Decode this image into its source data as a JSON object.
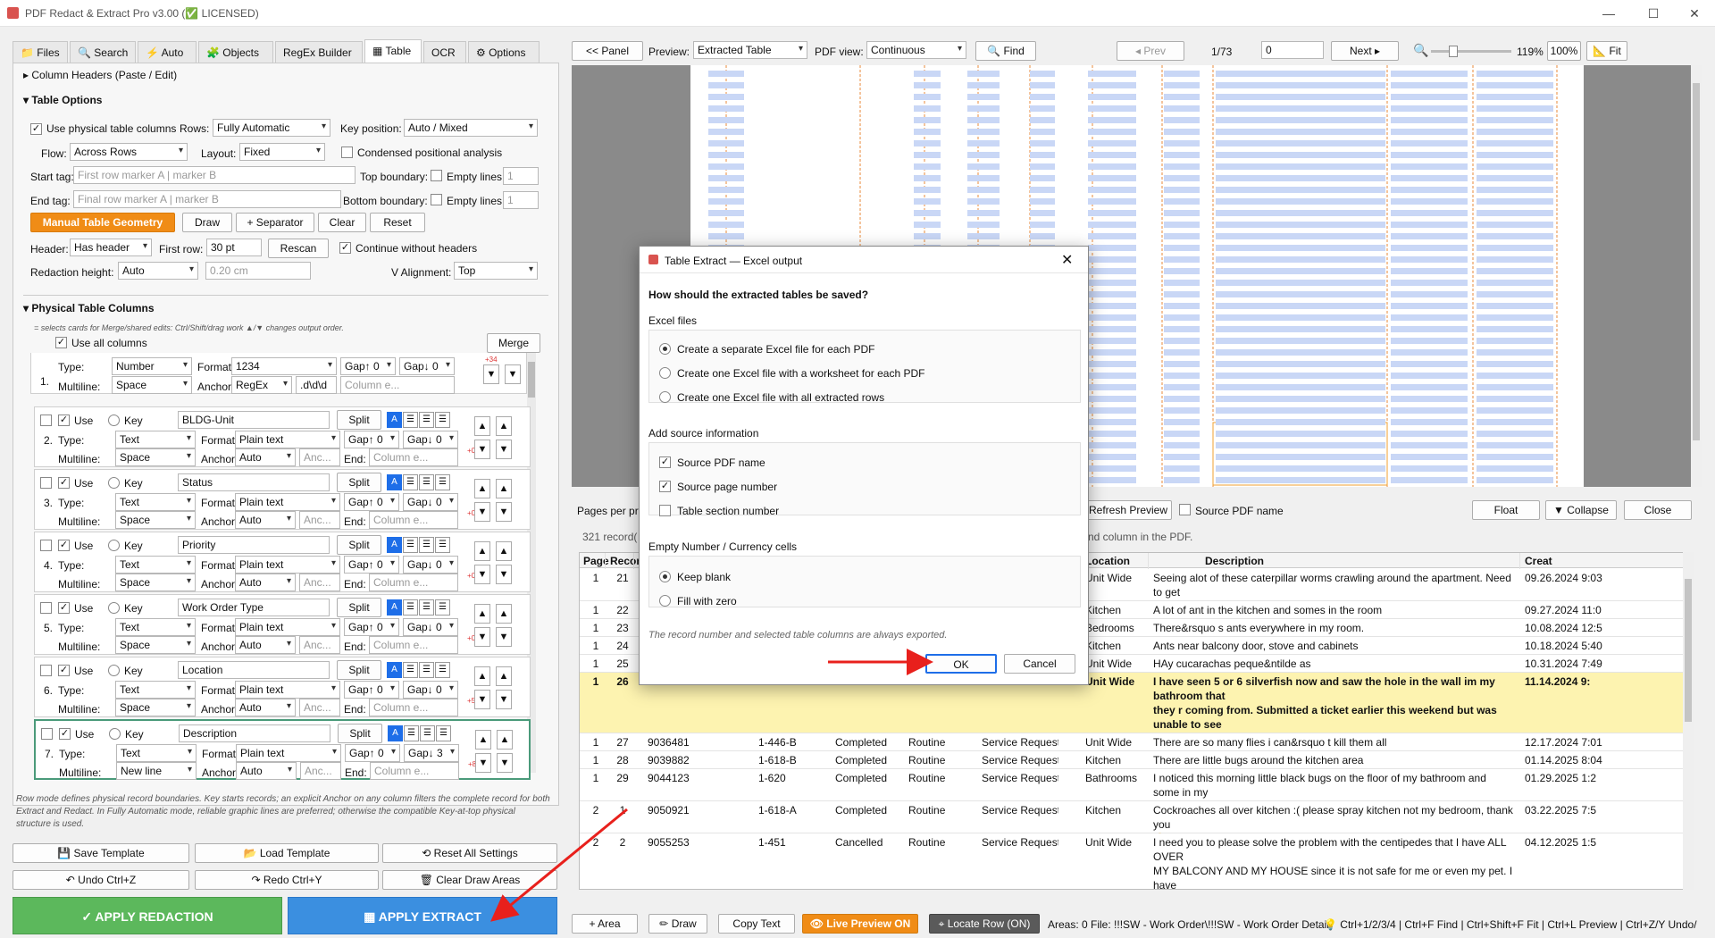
{
  "window": {
    "title": "PDF Redact & Extract Pro v3.00 (✅ LICENSED)",
    "controls": [
      "—",
      "☐",
      "✕"
    ]
  },
  "tabs": [
    "Files",
    "Search",
    "Auto",
    "Objects",
    "RegEx Builder",
    "Table",
    "OCR",
    "Options"
  ],
  "tab_icons": [
    "📁",
    "🔍",
    "⚡",
    "🧩",
    "",
    "▦",
    "",
    ""
  ],
  "left": {
    "column_headers_section": "Column Headers (Paste / Edit)",
    "table_options": "Table Options",
    "use_physical": "Use physical table columns",
    "rows_label": "Rows:",
    "rows_value": "Fully Automatic",
    "keypos_label": "Key position:",
    "keypos_value": "Auto / Mixed",
    "flow_label": "Flow:",
    "flow_value": "Across Rows",
    "layout_label": "Layout:",
    "layout_value": "Fixed",
    "condensed": "Condensed positional analysis",
    "start_tag": "Start tag:",
    "start_ph": "First row marker A | marker B",
    "top_boundary": "Top boundary:",
    "empty_lines": "Empty lines",
    "empty_val": "1",
    "end_tag": "End tag:",
    "end_ph": "Final row marker A | marker B",
    "bottom_boundary": "Bottom boundary:",
    "manual_btn": "Manual Table Geometry",
    "draw": "Draw",
    "separator": "+ Separator",
    "clear": "Clear",
    "reset": "Reset",
    "header_label": "Header:",
    "header_value": "Has header",
    "first_row_label": "First row:",
    "first_row_value": "30 pt",
    "rescan": "Rescan",
    "continue_wo": "Continue without headers",
    "redaction_height": "Redaction height:",
    "rh_value": "Auto",
    "rh2": "0.20 cm",
    "valign": "V Alignment:",
    "valign_value": "Top",
    "physical_cols": "Physical Table Columns",
    "hint": "= selects cards for Merge/shared edits: Ctrl/Shift/drag work  ▲/▼ changes output order.",
    "use_all": "Use all columns",
    "merge": "Merge",
    "note": "Row mode defines physical record boundaries. Key starts records; an explicit Anchor on any column filters the complete record for both Extract and Redact. In Fully Automatic mode, reliable graphic lines are preferred; otherwise the compatible Key-at-top physical structure is used.",
    "save_tpl": "Save Template",
    "load_tpl": "Load Template",
    "reset_all": "Reset All Settings",
    "undo": "Undo  Ctrl+Z",
    "redo": "Redo  Ctrl+Y",
    "clear_draw": "Clear Draw Areas",
    "apply_redaction": "APPLY REDACTION",
    "apply_extract": "APPLY EXTRACT"
  },
  "col1": {
    "num": "1.",
    "type": "Number",
    "format": "1234",
    "gap": "Gap↑ 0",
    "gap2": "Gap↓ 0",
    "multiline": "Space",
    "anchor": "RegEx",
    "anchor_end": ".d\\d\\d",
    "badge": "+34"
  },
  "columns": [
    {
      "num": "2.",
      "name": "BLDG-Unit",
      "type": "Text",
      "format": "Plain text",
      "gap": "Gap↑ 0",
      "gap2": "Gap↓ 0",
      "multiline": "Space",
      "anchor": "Auto",
      "badge": "+0"
    },
    {
      "num": "3.",
      "name": "Status",
      "type": "Text",
      "format": "Plain text",
      "gap": "Gap↑ 0",
      "gap2": "Gap↓ 0",
      "multiline": "Space",
      "anchor": "Auto",
      "badge": "+0"
    },
    {
      "num": "4.",
      "name": "Priority",
      "type": "Text",
      "format": "Plain text",
      "gap": "Gap↑ 0",
      "gap2": "Gap↓ 0",
      "multiline": "Space",
      "anchor": "Auto",
      "badge": "+0"
    },
    {
      "num": "5.",
      "name": "Work Order Type",
      "type": "Text",
      "format": "Plain text",
      "gap": "Gap↑ 0",
      "gap2": "Gap↓ 0",
      "multiline": "Space",
      "anchor": "Auto",
      "badge": "+0"
    },
    {
      "num": "6.",
      "name": "Location",
      "type": "Text",
      "format": "Plain text",
      "gap": "Gap↑ 0",
      "gap2": "Gap↓ 0",
      "multiline": "Space",
      "anchor": "Auto",
      "badge": "+5"
    },
    {
      "num": "7.",
      "name": "Description",
      "type": "Text",
      "format": "Plain text",
      "gap": "Gap↑ 0",
      "gap2": "Gap↓ 3",
      "multiline": "New line",
      "anchor": "Auto",
      "badge": "+87"
    }
  ],
  "card_labels": {
    "use": "Use",
    "key": "Key",
    "type": "Type:",
    "format": "Format:",
    "multiline": "Multiline:",
    "anchor": "Anchor:",
    "end": "End:",
    "split": "Split",
    "anc": "Anc...",
    "colph": "Column e...",
    "a": "A"
  },
  "toolbar": {
    "panel": "<< Panel",
    "preview_label": "Preview:",
    "preview_value": "Extracted Table",
    "pdfview_label": "PDF view:",
    "pdfview_value": "Continuous",
    "find": "Find",
    "prev": "◂ Prev",
    "page": "1/73",
    "page_input": "0",
    "next": "Next ▸",
    "zoom": "119%",
    "z100": "100%",
    "fit": "Fit"
  },
  "under_preview": {
    "pages_per": "Pages per pr",
    "refresh": "Refresh Preview",
    "source_pdf": "Source PDF name",
    "float": "Float",
    "collapse": "▼ Collapse",
    "close": "Close",
    "records": "321 record(",
    "hint2": "nd column in the PDF."
  },
  "table": {
    "headers": [
      "Page",
      "Recor",
      "",
      "",
      "",
      "",
      "",
      "Location",
      "Description",
      "Creat"
    ],
    "rows": [
      {
        "page": "1",
        "rec": "21",
        "wo": "",
        "unit": "",
        "status": "",
        "prio": "",
        "type": "",
        "loc": "Unit Wide",
        "desc": "Seeing alot of these caterpillar worms crawling around the apartment. Need to get\nthis resolved.",
        "created": "09.26.2024 9:03"
      },
      {
        "page": "1",
        "rec": "22",
        "wo": "",
        "unit": "",
        "status": "",
        "prio": "",
        "type": "",
        "loc": "Kitchen",
        "desc": "A lot of ant in the kitchen and somes in the room",
        "created": "09.27.2024 11:0"
      },
      {
        "page": "1",
        "rec": "23",
        "wo": "",
        "unit": "",
        "status": "",
        "prio": "",
        "type": "",
        "loc": "Bedrooms",
        "desc": "There&rsquo s ants everywhere in my room.",
        "created": "10.08.2024 12:5"
      },
      {
        "page": "1",
        "rec": "24",
        "wo": "",
        "unit": "",
        "status": "",
        "prio": "",
        "type": "",
        "loc": "Kitchen",
        "desc": "Ants near balcony door, stove and cabinets",
        "created": "10.18.2024 5:40"
      },
      {
        "page": "1",
        "rec": "25",
        "wo": "",
        "unit": "",
        "status": "",
        "prio": "",
        "type": "",
        "loc": "Unit Wide",
        "desc": "HAy cucarachas peque&ntilde as",
        "created": "10.31.2024 7:49"
      },
      {
        "page": "1",
        "rec": "26",
        "wo": "",
        "unit": "",
        "status": "",
        "prio": "",
        "type": "",
        "loc": "Unit Wide",
        "desc": "I have seen 5 or 6 silverfish now and saw the hole in the wall im my bathroom that\nthey r coming from. Submitted a ticket earlier this weekend but was unable to see\nthe response and it was closed. I just moved in last month and my apartment is\nalready infested with insects? Am i expected to pay to fix this on my own?",
        "created": "11.14.2024 9:"
      },
      {
        "page": "1",
        "rec": "27",
        "wo": "9036481",
        "unit": "1-446-B",
        "status": "Completed",
        "prio": "Routine",
        "type": "Service Request",
        "loc": "Unit Wide",
        "desc": "There are so many flies i can&rsquo t kill them all",
        "created": "12.17.2024 7:01"
      },
      {
        "page": "1",
        "rec": "28",
        "wo": "9039882",
        "unit": "1-618-B",
        "status": "Completed",
        "prio": "Routine",
        "type": "Service Request",
        "loc": "Kitchen",
        "desc": "There are little bugs around the kitchen area",
        "created": "01.14.2025 8:04"
      },
      {
        "page": "1",
        "rec": "29",
        "wo": "9044123",
        "unit": "1-620",
        "status": "Completed",
        "prio": "Routine",
        "type": "Service Request",
        "loc": "Bathrooms",
        "desc": "I noticed this morning little black bugs on the floor of my bathroom and some in my\nliving room. I&rsquo m unsure where they are coming from",
        "created": "01.29.2025 1:2"
      },
      {
        "page": "2",
        "rec": "1",
        "wo": "9050921",
        "unit": "1-618-A",
        "status": "Completed",
        "prio": "Routine",
        "type": "Service Request",
        "loc": "Kitchen",
        "desc": "Cockroaches all over kitchen :( please spray kitchen not my bedroom, thank you\n🙏♡♡",
        "created": "03.22.2025 7:5"
      },
      {
        "page": "2",
        "rec": "2",
        "wo": "9055253",
        "unit": "1-451",
        "status": "Cancelled",
        "prio": "Routine",
        "type": "Service Request",
        "loc": "Unit Wide",
        "desc": "I need you to please solve the problem with the centipedes that I have ALL OVER\nMY BALCONY AND MY HOUSE since it is not safe for me or even my pet. I have\nants and centipedes. You need to do something with the grass below. I'll take care\nof my apartment! But I need you to solve this problem since I've been trying to find\na solution since Saturday and nothing has happened. Today I went to the office but",
        "created": "04.12.2025 1:5"
      }
    ]
  },
  "modal": {
    "title": "Table Extract — Excel output",
    "question": "How should the extracted tables be saved?",
    "excel_files": "Excel files",
    "opt1": "Create a separate Excel file for each PDF",
    "opt2": "Create one Excel file with a worksheet for each PDF",
    "opt3": "Create one Excel file with all extracted rows",
    "add_source": "Add source information",
    "src1": "Source PDF name",
    "src2": "Source page number",
    "src3": "Table section number",
    "empty_cells": "Empty Number / Currency cells",
    "keep": "Keep blank",
    "fill": "Fill with zero",
    "note": "The record number and selected table columns are always exported.",
    "ok": "OK",
    "cancel": "Cancel"
  },
  "status": {
    "area": "+ Area",
    "draw": "Draw",
    "copy": "Copy Text",
    "live": "Live Preview ON",
    "locate": "Locate Row (ON)",
    "info": "Areas: 0  File: !!!SW - Work Order\\!!!SW - Work Order Detail:",
    "shortcuts": "💡 Ctrl+1/2/3/4 | Ctrl+F Find | Ctrl+Shift+F Fit | Ctrl+L Preview | Ctrl+Z/Y Undo/"
  },
  "colors": {
    "accent": "#1e6ee8",
    "orange": "#f08c16",
    "green": "#5cb85c",
    "blue": "#3b8fe0",
    "highlight": "#fdf3b0",
    "red_arrow": "#e8201c"
  }
}
